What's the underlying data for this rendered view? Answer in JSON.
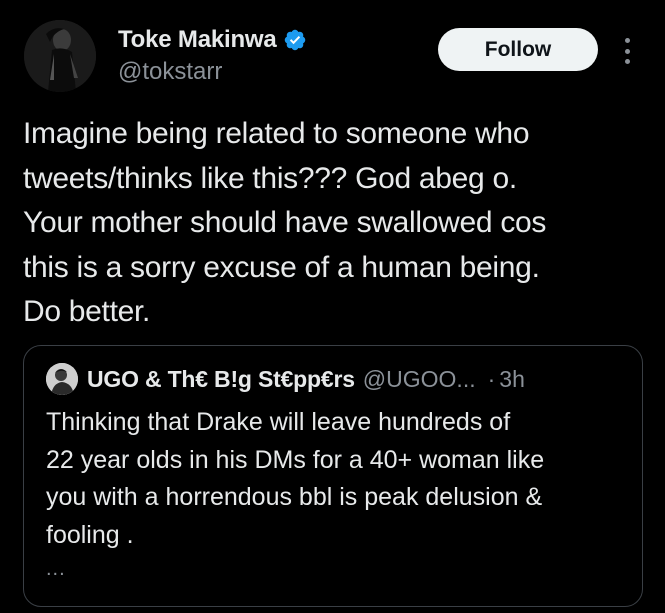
{
  "author": {
    "display_name": "Toke Makinwa",
    "handle": "@tokstarr",
    "verified": true,
    "avatar_icon": "profile-photo"
  },
  "actions": {
    "follow_label": "Follow",
    "more_icon": "more-vertical-icon"
  },
  "tweet": {
    "lines": [
      "Imagine being related to someone who",
      "tweets/thinks like this??? God abeg o.",
      "Your mother should have swallowed cos",
      "this is a sorry excuse of a human being.",
      "Do better."
    ]
  },
  "quoted_tweet": {
    "display_name": "UGO & Th€ B!g St€pp€rs",
    "handle": "@UGOO...",
    "separator": "·",
    "time": "3h",
    "lines": [
      "Thinking that Drake will leave hundreds of",
      "22 year olds in his DMs for a 40+ woman like",
      "you with a horrendous bbl is peak delusion &",
      "fooling ."
    ],
    "truncation": "..."
  },
  "colors": {
    "background": "#000000",
    "text": "#e7e9ea",
    "secondary_text": "#8b9198",
    "verified_blue": "#1d9bf0",
    "follow_bg": "#eff3f4"
  }
}
